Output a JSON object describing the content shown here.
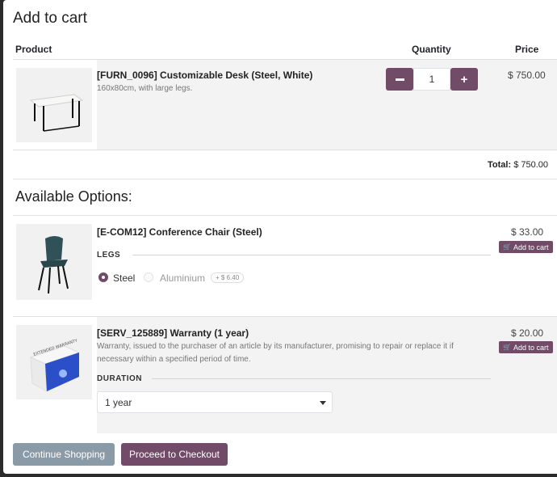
{
  "dialog": {
    "title": "Add to cart"
  },
  "table": {
    "headers": {
      "product": "Product",
      "quantity": "Quantity",
      "price": "Price"
    }
  },
  "main_product": {
    "name": "[FURN_0096] Customizable Desk (Steel, White)",
    "description": "160x80cm, with large legs.",
    "quantity": "1",
    "price": "$ 750.00",
    "image_icon": "desk-icon"
  },
  "total": {
    "label": "Total:",
    "value": "$ 750.00"
  },
  "options": {
    "heading": "Available Options:",
    "items": [
      {
        "name": "[E-COM12] Conference Chair (Steel)",
        "price": "$ 33.00",
        "add_label": "Add to cart",
        "attribute_label": "LEGS",
        "choices": [
          {
            "label": "Steel",
            "selected": true
          },
          {
            "label": "Aluminium",
            "selected": false,
            "extra": "+ $ 6.40"
          }
        ],
        "image_icon": "chair-icon"
      },
      {
        "name": "[SERV_125889] Warranty (1 year)",
        "description": "Warranty, issued to the purchaser of an article by its manufacturer, promising to repair or replace it if necessary within a specified period of time.",
        "price": "$ 20.00",
        "add_label": "Add to cart",
        "attribute_label": "DURATION",
        "selected_value": "1 year",
        "image_icon": "warranty-box-icon",
        "box_text": "EXTENDED WARRANTY"
      }
    ]
  },
  "footer": {
    "continue_label": "Continue Shopping",
    "checkout_label": "Proceed to Checkout"
  },
  "colors": {
    "primary": "#714b67",
    "secondary": "#8a9aa6"
  }
}
